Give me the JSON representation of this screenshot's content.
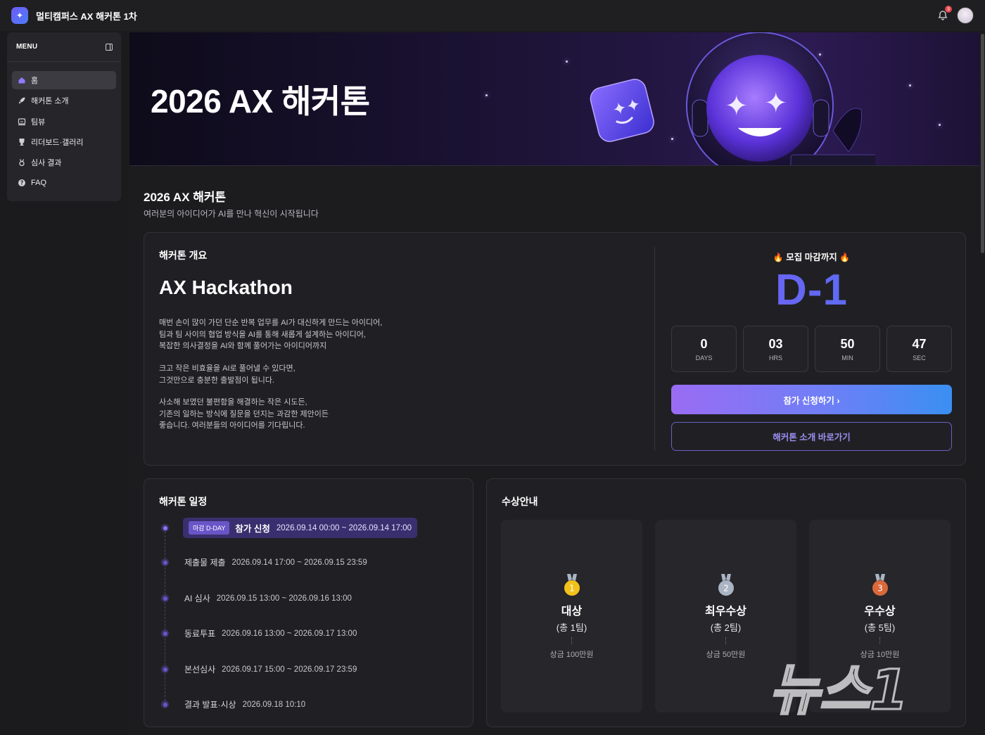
{
  "app": {
    "title": "멀티캠퍼스 AX 해커톤 1차",
    "notification_count": "3"
  },
  "sidebar": {
    "menu_label": "MENU",
    "items": [
      {
        "label": "홈",
        "icon": "home-icon"
      },
      {
        "label": "해커톤 소개",
        "icon": "rocket-icon"
      },
      {
        "label": "팀뷰",
        "icon": "team-icon"
      },
      {
        "label": "리더보드·갤러리",
        "icon": "trophy-icon"
      },
      {
        "label": "심사 결과",
        "icon": "medal-icon"
      },
      {
        "label": "FAQ",
        "icon": "question-icon"
      }
    ]
  },
  "banner": {
    "title": "2026 AX 해커톤"
  },
  "page": {
    "title": "2026 AX 해커톤",
    "subtitle": "여러분의 아이디어가 AI를 만나 혁신이 시작됩니다"
  },
  "overview": {
    "section_title": "해커톤 개요",
    "heading": "AX Hackathon",
    "paragraphs": [
      [
        "매번 손이 많이 가던 단순 반복 업무를 AI가 대신하게 만드는 아이디어,",
        "팀과 팀 사이의 협업 방식을 AI를 통해 새롭게 설계하는 아이디어,",
        "복잡한 의사결정을 AI와 함께 풀어가는 아이디어까지"
      ],
      [
        "크고 작은 비효율을 AI로 풀어낼 수 있다면,",
        "그것만으로 충분한 출발점이 됩니다."
      ],
      [
        "사소해 보였던 불편함을 해결하는 작은 시도든,",
        "기존의 일하는 방식에 질문을 던지는 과감한 제안이든",
        "좋습니다. 여러분들의 아이디어를 기다립니다."
      ]
    ]
  },
  "deadline": {
    "label": "모집 마감까지",
    "dday": "D-1",
    "countdown": [
      {
        "value": "0",
        "unit": "DAYS"
      },
      {
        "value": "03",
        "unit": "HRS"
      },
      {
        "value": "50",
        "unit": "MIN"
      },
      {
        "value": "47",
        "unit": "SEC"
      }
    ],
    "apply_button": "참가 신청하기 ›",
    "intro_button": "해커톤 소개 바로가기"
  },
  "schedule": {
    "title": "해커톤 일정",
    "items": [
      {
        "badge": "마감 D-DAY",
        "name": "참가 신청",
        "date": "2026.09.14 00:00 ~ 2026.09.14 17:00",
        "active": true
      },
      {
        "name": "제출물 제출",
        "date": "2026.09.14 17:00 ~ 2026.09.15 23:59"
      },
      {
        "name": "AI 심사",
        "date": "2026.09.15 13:00 ~ 2026.09.16 13:00"
      },
      {
        "name": "동료투표",
        "date": "2026.09.16 13:00 ~ 2026.09.17 13:00"
      },
      {
        "name": "본선심사",
        "date": "2026.09.17 15:00 ~ 2026.09.17 23:59"
      },
      {
        "name": "결과 발표·시상",
        "date": "2026.09.18 10:10"
      }
    ]
  },
  "awards": {
    "title": "수상안내",
    "items": [
      {
        "rank": "1",
        "name": "대상",
        "count": "(총 1팀)",
        "prize": "상금 100만원",
        "color": "#f2c21b"
      },
      {
        "rank": "2",
        "name": "최우수상",
        "count": "(총 2팀)",
        "prize": "상금 50만원",
        "color": "#aab4c3"
      },
      {
        "rank": "3",
        "name": "우수상",
        "count": "(총 5팀)",
        "prize": "상금 10만원",
        "color": "#d9683a"
      }
    ]
  },
  "watermark": {
    "text": "뉴스1"
  }
}
